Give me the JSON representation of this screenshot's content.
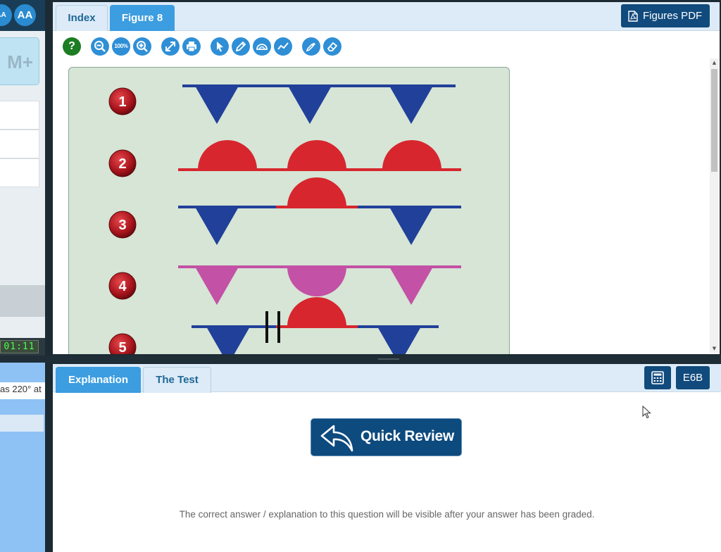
{
  "left_top": {
    "font_decrease_label": "AA",
    "font_increase_label": "AA",
    "memory_button_label": "M+",
    "timer": "01:11"
  },
  "figure_panel": {
    "tabs": [
      {
        "label": "Index",
        "active": false
      },
      {
        "label": "Figure 8",
        "active": true
      }
    ],
    "pdf_button_label": "Figures PDF",
    "toolbar": {
      "help_label": "?",
      "zoom_100_label": "100%",
      "tools": [
        "help-icon",
        "zoom-out-icon",
        "zoom-100-icon",
        "zoom-in-icon",
        "fit-screen-icon",
        "print-icon",
        "pointer-icon",
        "pencil-icon",
        "protractor-icon",
        "freehand-line-icon",
        "color-picker-icon",
        "eraser-icon"
      ]
    },
    "figure": {
      "rows": [
        {
          "number": "1",
          "color": "#21409a",
          "pattern": [
            "V",
            "V",
            "V"
          ]
        },
        {
          "number": "2",
          "color": "#d7262e",
          "pattern": [
            "D",
            "D",
            "D"
          ]
        },
        {
          "number": "3",
          "color": "#21409a",
          "accent": "#d7262e",
          "pattern": [
            "V",
            "D",
            "V"
          ]
        },
        {
          "number": "4",
          "color": "#c351a5",
          "pattern": [
            "V",
            "U",
            "V"
          ]
        },
        {
          "number": "5",
          "color": "#21409a",
          "accent": "#d7262e",
          "pattern": [
            "V",
            "D",
            "V"
          ],
          "break_marker": true
        }
      ]
    }
  },
  "explanation_panel": {
    "tabs": [
      {
        "label": "Explanation",
        "active": true
      },
      {
        "label": "The Test",
        "active": false
      }
    ],
    "calculator_icon": "calculator-icon",
    "code_button_label": "E6B",
    "quick_review_label": "Quick Review",
    "message": "The correct answer / explanation to this question will be visible after your answer has been graded."
  },
  "left_bottom": {
    "snippet": "as 220° at"
  },
  "colors": {
    "accent_blue": "#3c9de0",
    "dark_button": "#114a7c",
    "figure_bg": "#d6e5d5"
  }
}
